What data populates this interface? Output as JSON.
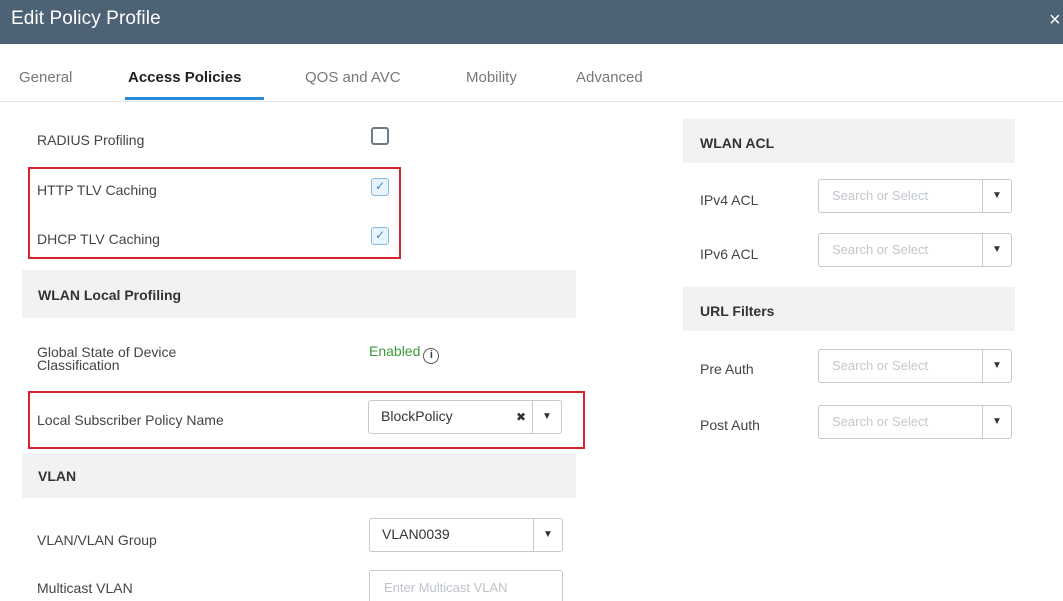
{
  "dialog": {
    "title": "Edit Policy Profile",
    "close_glyph": "×"
  },
  "tabs": [
    {
      "label": "General"
    },
    {
      "label": "Access Policies",
      "active": true
    },
    {
      "label": "QOS and AVC"
    },
    {
      "label": "Mobility"
    },
    {
      "label": "Advanced"
    }
  ],
  "left": {
    "radius_profiling": {
      "label": "RADIUS Profiling",
      "checked": false
    },
    "http_tlv": {
      "label": "HTTP TLV Caching",
      "checked": true
    },
    "dhcp_tlv": {
      "label": "DHCP TLV Caching",
      "checked": true
    },
    "wlan_local_profiling": {
      "title": "WLAN Local Profiling"
    },
    "global_state": {
      "label_line1": "Global State of Device",
      "label_line2": "Classification",
      "value": "Enabled",
      "info_glyph": "i"
    },
    "local_subscriber": {
      "label": "Local Subscriber Policy Name",
      "value": "BlockPolicy",
      "clear_glyph": "✖",
      "arrow_glyph": "▼"
    },
    "vlan_section": {
      "title": "VLAN"
    },
    "vlan_group": {
      "label": "VLAN/VLAN Group",
      "value": "VLAN0039",
      "arrow_glyph": "▼"
    },
    "multicast_vlan": {
      "label": "Multicast VLAN",
      "placeholder": "Enter Multicast VLAN"
    }
  },
  "right": {
    "wlan_acl": {
      "title": "WLAN ACL"
    },
    "ipv4_acl": {
      "label": "IPv4 ACL",
      "placeholder": "Search or Select",
      "arrow_glyph": "▼"
    },
    "ipv6_acl": {
      "label": "IPv6 ACL",
      "placeholder": "Search or Select",
      "arrow_glyph": "▼"
    },
    "url_filters": {
      "title": "URL Filters"
    },
    "pre_auth": {
      "label": "Pre Auth",
      "placeholder": "Search or Select",
      "arrow_glyph": "▼"
    },
    "post_auth": {
      "label": "Post Auth",
      "placeholder": "Search or Select",
      "arrow_glyph": "▼"
    }
  },
  "colors": {
    "titlebar": "#4d6274",
    "tab_active_underline": "#2b8ad6",
    "highlight_box": "#d8242f",
    "enabled_text": "#3a9b3a"
  },
  "icons": {
    "close": "close-icon",
    "checkmark": "checkmark-icon",
    "info": "info-icon",
    "dropdown": "chevron-down-icon",
    "clear": "clear-icon"
  }
}
